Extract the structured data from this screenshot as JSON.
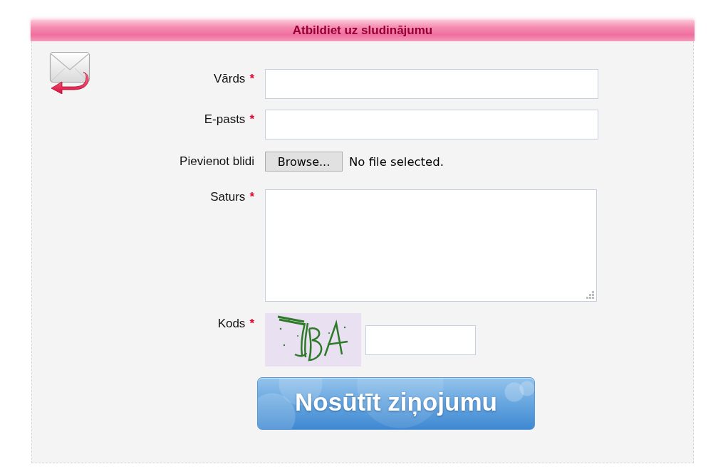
{
  "panel": {
    "title": "Atbildiet uz sludinājumu"
  },
  "fields": [
    {
      "kind": "text",
      "label": "Vārds",
      "marker": "*"
    },
    {
      "kind": "text",
      "label": "E-pasts",
      "marker": "*"
    },
    {
      "kind": "file",
      "label": "Pievienot blidi",
      "button": "Browse...",
      "status": "No file selected."
    },
    {
      "kind": "textarea",
      "label": "Saturs",
      "marker": "*"
    },
    {
      "kind": "captcha",
      "label": "Kods",
      "marker": "*"
    }
  ],
  "submit": "Nosūtīt ziņojumu"
}
